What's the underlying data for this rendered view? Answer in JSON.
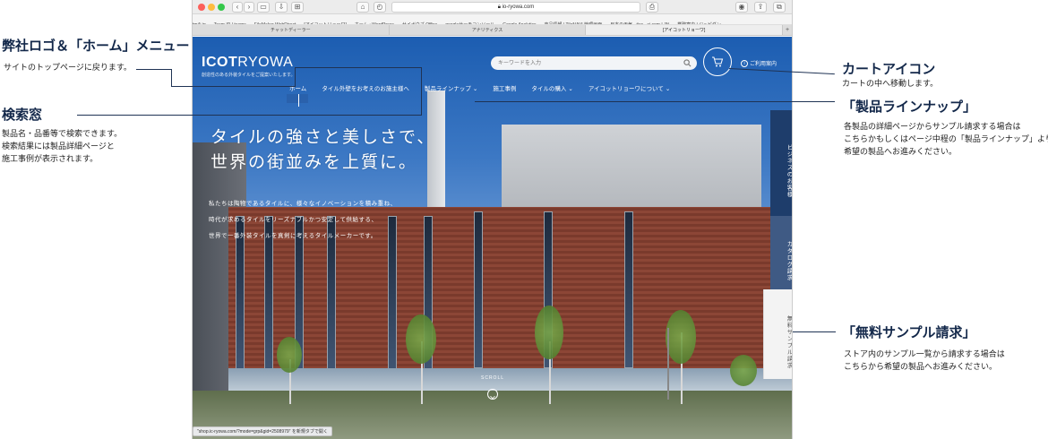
{
  "browser": {
    "url": "io-ryowa.com",
    "bookmarks": [
      "tm4i.jp",
      "Team IR | tcams",
      "FileMaker WebDirect",
      "[アイコットリョーワ]",
      "ホーム ‹ WordPress",
      "サイボウズ Office",
      "googleサーチコンソール",
      "Google Analytics",
      "商品情報 | TileNAVI 管理画面",
      "日本の天気 - ticc...ai.com | JN",
      "業務案内 | ジュピダン"
    ],
    "tabs": [
      "チャットディーラー",
      "アナリティクス",
      "[アイコットリョーワ]"
    ],
    "tab_plus": "+",
    "status_url": "\"shop.ic-ryowa.com/?mode=grp&gid=2508979\" を新規タブで開く"
  },
  "site": {
    "logo_bold": "ICOT",
    "logo_light": "RYOWA",
    "logo_sub": "創造性のある外装タイルをご提案いたします。",
    "search_placeholder": "キーワードを入力",
    "guide_label": "ご利用案内",
    "info_glyph": "i",
    "nav": [
      "ホーム",
      "タイル外壁をお考えのお施主様へ",
      "製品ラインナップ ⌄",
      "施工事例",
      "タイルの購入 ⌄",
      "アイコットリョーワについて ⌄"
    ],
    "hero_heading_1": "タイルの強さと美しさで、",
    "hero_heading_2": "世界の街並みを上質に。",
    "hero_body": [
      "私たちは陶物であるタイルに、様々なイノベーションを積み重ね、",
      "時代が求めるタイルをリーズナブルかつ安定して供給する、",
      "世界で一番外装タイルを真剣に考えるタイルメーカーです。"
    ],
    "side_tabs": {
      "business": "ビジネスのお客様",
      "catalog": "カタログ請求",
      "sample": "無料サンプル請求"
    },
    "scroll_label": "SCROLL"
  },
  "annotations": {
    "logo_menu": {
      "title": "弊社ロゴ＆「ホーム」メニュー",
      "desc": [
        "サイトのトップページに戻ります。"
      ]
    },
    "search": {
      "title": "検索窓",
      "desc": [
        "製品名・品番等で検索できます。",
        "検索結果には製品詳細ページと",
        "施工事例が表示されます。"
      ]
    },
    "cart": {
      "title": "カートアイコン",
      "desc": [
        "カートの中へ移動します。"
      ]
    },
    "lineup": {
      "title": "「製品ラインナップ」",
      "desc": [
        "各製品の詳細ページからサンプル請求する場合は",
        "こちらかもしくはページ中程の「製品ラインナップ」より",
        "希望の製品へお進みください。"
      ]
    },
    "sample": {
      "title": "「無料サンプル請求」",
      "desc": [
        "ストア内のサンプル一覧から請求する場合は",
        "こちらから希望の製品へお進みください。"
      ]
    }
  }
}
